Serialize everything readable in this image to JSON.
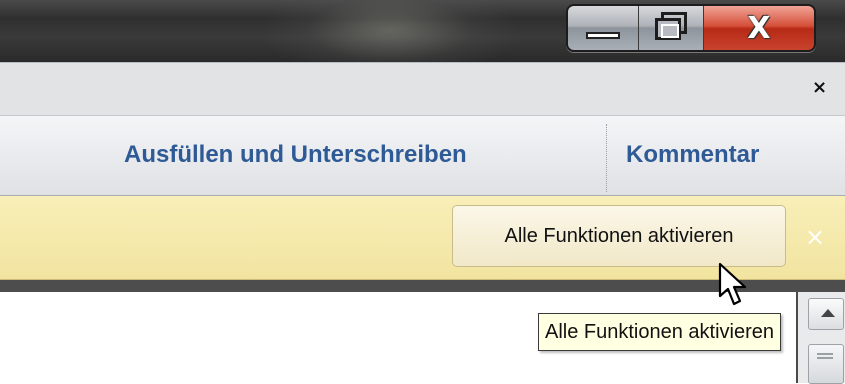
{
  "window": {
    "caption_buttons": [
      {
        "name": "minimize",
        "icon": "minimize-icon"
      },
      {
        "name": "maximize",
        "icon": "restore-icon"
      },
      {
        "name": "close",
        "icon": "close-icon",
        "glyph": "X"
      }
    ]
  },
  "tabstrip": {
    "close_glyph": "×"
  },
  "tools": {
    "fill_sign_label": "Ausfüllen und Unterschreiben",
    "comment_label": "Kommentar"
  },
  "message_bar": {
    "enable_button_label": "Alle Funktionen aktivieren",
    "close_glyph": "×"
  },
  "tooltip": {
    "text": "Alle Funktionen aktivieren"
  },
  "colors": {
    "tool_link": "#2e5a96",
    "message_bar": "#f2e4a0",
    "tooltip_bg": "#ffffe1",
    "close_button": "#c9432e"
  }
}
